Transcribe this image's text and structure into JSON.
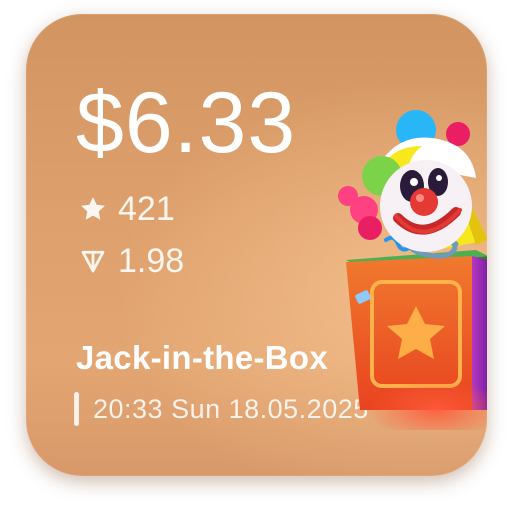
{
  "gift": {
    "price": "$6.33",
    "stars": "421",
    "ton": "1.98",
    "title": "Jack-in-the-Box",
    "datetime": "20:33 Sun 18.05.2025"
  },
  "icons": {
    "stars": "star-icon",
    "ton": "ton-icon",
    "sticker": "jack-in-the-box-clown"
  },
  "colors": {
    "card_top": "#d29561",
    "card_bottom": "#e3a672",
    "text": "#ffffff"
  }
}
